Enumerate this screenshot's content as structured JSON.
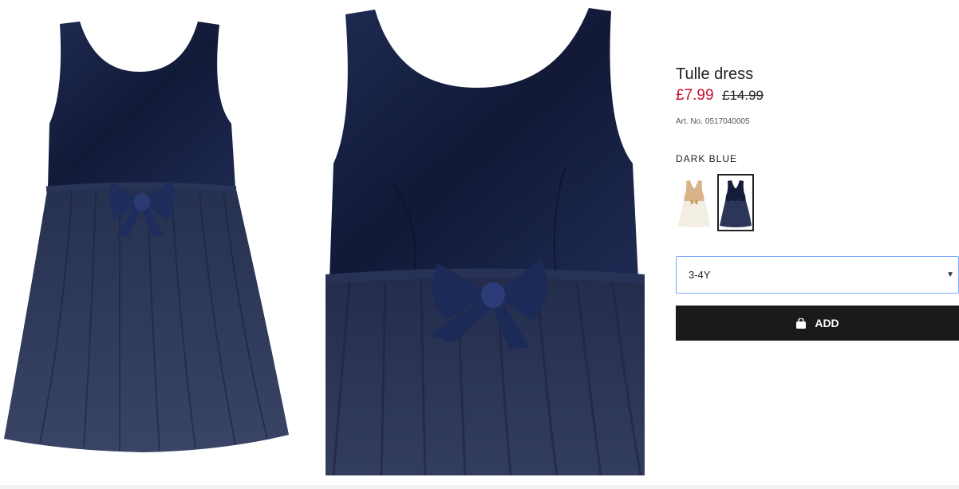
{
  "product": {
    "title": "Tulle dress",
    "price_sale": "£7.99",
    "price_original": "£14.99",
    "article_label": "Art. No.",
    "article_number": "0517040005"
  },
  "color": {
    "selected_name": "DARK BLUE",
    "swatches": [
      {
        "name": "beige-dress-swatch",
        "selected": false
      },
      {
        "name": "dark-blue-dress-swatch",
        "selected": true
      }
    ]
  },
  "size": {
    "selected": "3-4Y"
  },
  "actions": {
    "add_label": "ADD",
    "add_icon": "shopping-bag-icon"
  },
  "colors": {
    "sale_red": "#c8102e",
    "button_black": "#1a1a1a",
    "dress_navy": "#1b2546",
    "focus_blue": "#7aa7ff"
  }
}
